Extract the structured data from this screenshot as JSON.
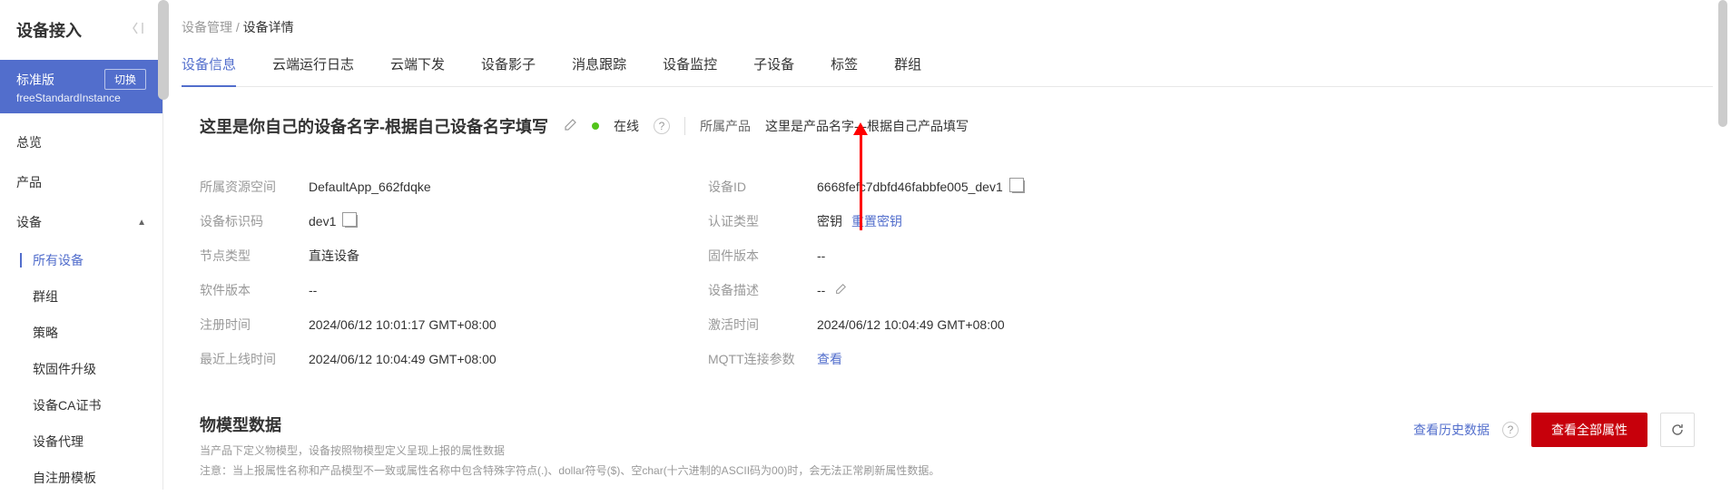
{
  "sidebar": {
    "title": "设备接入",
    "instance": {
      "name": "标准版",
      "switch_label": "切换",
      "sub": "freeStandardInstance"
    },
    "nav": {
      "overview": "总览",
      "product": "产品",
      "device": "设备",
      "sub": {
        "all_devices": "所有设备",
        "groups": "群组",
        "policies": "策略",
        "firmware": "软固件升级",
        "ca": "设备CA证书",
        "proxy": "设备代理",
        "self_register": "自注册模板"
      }
    }
  },
  "breadcrumb": {
    "parent": "设备管理",
    "current": "设备详情"
  },
  "tabs": {
    "info": "设备信息",
    "cloud_log": "云端运行日志",
    "cloud_send": "云端下发",
    "shadow": "设备影子",
    "msg_trace": "消息跟踪",
    "monitor": "设备监控",
    "sub_device": "子设备",
    "tags": "标签",
    "groups": "群组"
  },
  "device": {
    "name": "这里是你自己的设备名字-根据自己设备名字填写",
    "status": "在线",
    "product_label": "所属产品",
    "product_name": "这里是产品名字---根据自己产品填写"
  },
  "fields_left": {
    "space_label": "所属资源空间",
    "space_value": "DefaultApp_662fdqke",
    "code_label": "设备标识码",
    "code_value": "dev1",
    "node_label": "节点类型",
    "node_value": "直连设备",
    "sw_label": "软件版本",
    "sw_value": "--",
    "reg_label": "注册时间",
    "reg_value": "2024/06/12 10:01:17 GMT+08:00",
    "last_label": "最近上线时间",
    "last_value": "2024/06/12 10:04:49 GMT+08:00"
  },
  "fields_right": {
    "id_label": "设备ID",
    "id_value": "6668fefc7dbfd46fabbfe005_dev1",
    "auth_label": "认证类型",
    "auth_value": "密钥",
    "auth_link": "重置密钥",
    "fw_label": "固件版本",
    "fw_value": "--",
    "desc_label": "设备描述",
    "desc_value": "--",
    "active_label": "激活时间",
    "active_value": "2024/06/12 10:04:49 GMT+08:00",
    "mqtt_label": "MQTT连接参数",
    "mqtt_link": "查看"
  },
  "model": {
    "title": "物模型数据",
    "desc1": "当产品下定义物模型，设备按照物模型定义呈现上报的属性数据",
    "desc2": "注意：当上报属性名称和产品模型不一致或属性名称中包含特殊字符点(.)、dollar符号($)、空char(十六进制的ASCII码为00)时，会无法正常刷新属性数据。",
    "history_link": "查看历史数据",
    "all_props_btn": "查看全部属性"
  }
}
